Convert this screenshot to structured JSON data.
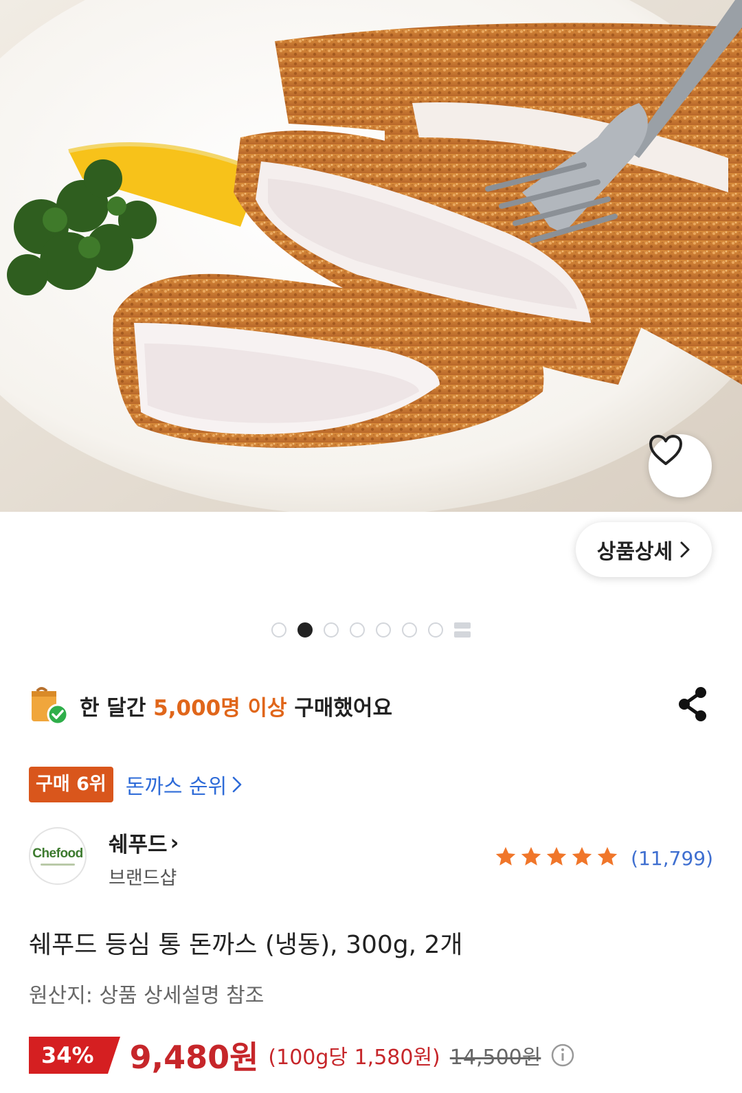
{
  "product_image": {
    "alt": "",
    "dots_total": 8,
    "active_index": 1
  },
  "detail_button": {
    "label": "상품상세",
    "chevron": "›"
  },
  "purchase_banner": {
    "prefix": "한 달간 ",
    "highlight": "5,000명 이상",
    "suffix": " 구매했어요"
  },
  "ranking": {
    "badge": "구매 6위",
    "link_label": "돈까스 순위",
    "chevron": "›"
  },
  "brand": {
    "logo_text": "Chefood",
    "name": "쉐푸드",
    "chevron": "›",
    "subtitle": "브랜드샵"
  },
  "rating": {
    "stars": 5,
    "count": "(11,799)"
  },
  "product": {
    "title": "쉐푸드 등심 통 돈까스 (냉동), 300g, 2개",
    "origin": "원산지: 상품 상세설명 참조"
  },
  "price": {
    "discount": "34%",
    "sale": "9,480원",
    "unit_price": "(100g당 1,580원)",
    "original": "14,500원"
  },
  "colors": {
    "accent_orange": "#e0661a",
    "rank_badge": "#d9561c",
    "link_blue": "#2e6bd8",
    "price_red": "#c6262a",
    "discount_red": "#d51f21",
    "star": "#f0762a"
  }
}
